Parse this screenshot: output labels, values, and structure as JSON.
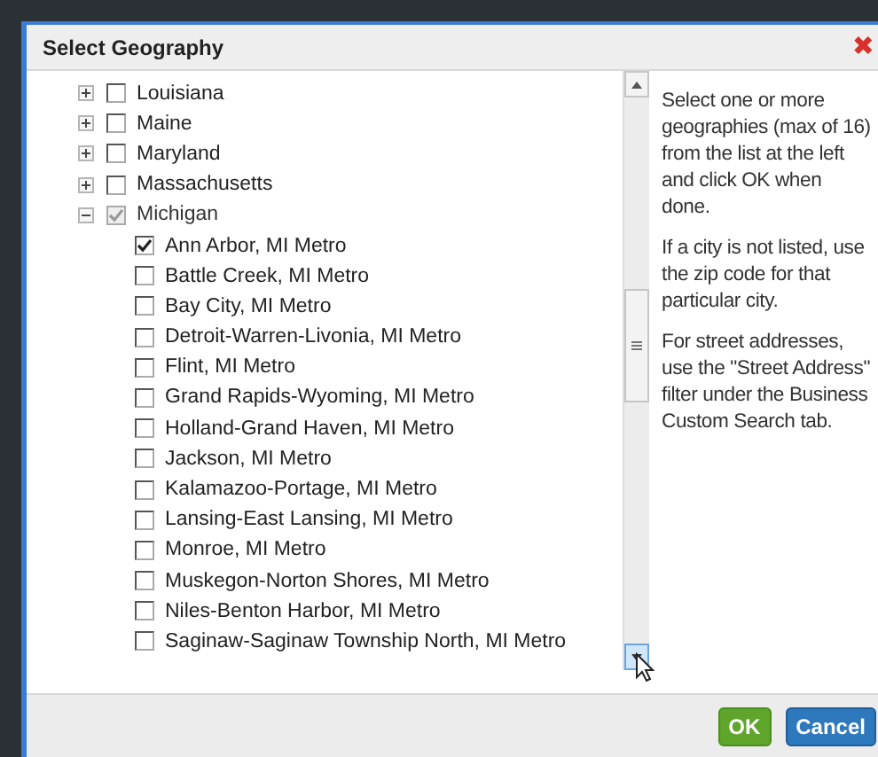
{
  "dialog": {
    "title": "Select Geography",
    "close": "✖"
  },
  "tree": [
    {
      "label": "Louisiana",
      "expanded": false,
      "checked": false,
      "dimmed": false
    },
    {
      "label": "Maine",
      "expanded": false,
      "checked": false,
      "dimmed": false
    },
    {
      "label": "Maryland",
      "expanded": false,
      "checked": false,
      "dimmed": false
    },
    {
      "label": "Massachusetts",
      "expanded": false,
      "checked": false,
      "dimmed": false
    },
    {
      "label": "Michigan",
      "expanded": true,
      "checked": true,
      "dimmed": true,
      "children": [
        {
          "label": "Ann Arbor, MI Metro",
          "checked": true
        },
        {
          "label": "Battle Creek, MI Metro",
          "checked": false
        },
        {
          "label": "Bay City, MI Metro",
          "checked": false
        },
        {
          "label": "Detroit-Warren-Livonia, MI Metro",
          "checked": false
        },
        {
          "label": "Flint, MI Metro",
          "checked": false
        },
        {
          "label": "Grand Rapids-Wyoming, MI Metro",
          "checked": false
        },
        {
          "label": "Holland-Grand Haven, MI Metro",
          "checked": false
        },
        {
          "label": "Jackson, MI Metro",
          "checked": false
        },
        {
          "label": "Kalamazoo-Portage, MI Metro",
          "checked": false
        },
        {
          "label": "Lansing-East Lansing, MI Metro",
          "checked": false
        },
        {
          "label": "Monroe, MI Metro",
          "checked": false
        },
        {
          "label": "Muskegon-Norton Shores, MI Metro",
          "checked": false
        },
        {
          "label": "Niles-Benton Harbor, MI Metro",
          "checked": false
        },
        {
          "label": "Saginaw-Saginaw Township North, MI Metro",
          "checked": false
        }
      ]
    }
  ],
  "help": [
    "Select one or more geographies (max of 16) from the list at the left and click OK when done.",
    "If a city is not listed, use the zip code for that particular city.",
    "For street addresses, use the \"Street Address\" filter under the Business Custom Search tab."
  ],
  "buttons": [
    {
      "label": "OK",
      "kind": "primary"
    },
    {
      "label": "Cancel",
      "kind": "secondary"
    }
  ]
}
